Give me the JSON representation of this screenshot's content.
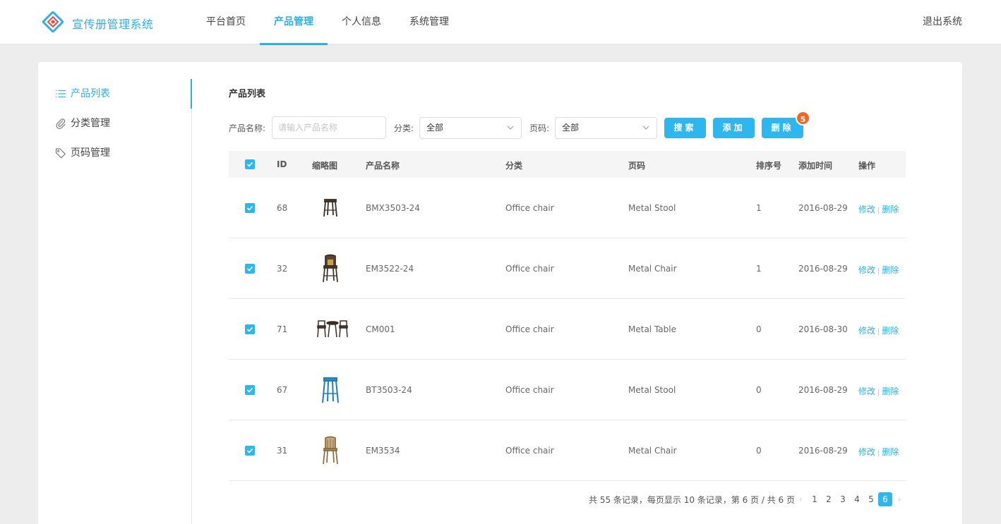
{
  "app": {
    "title": "宣传册管理系统"
  },
  "nav": {
    "items": [
      {
        "label": "平台首页"
      },
      {
        "label": "产品管理"
      },
      {
        "label": "个人信息"
      },
      {
        "label": "系统管理"
      }
    ],
    "active": "产品管理",
    "logout": "退出系统"
  },
  "sidebar": {
    "items": [
      {
        "label": "产品列表",
        "icon": "list-icon"
      },
      {
        "label": "分类管理",
        "icon": "paperclip-icon"
      },
      {
        "label": "页码管理",
        "icon": "tag-icon"
      }
    ],
    "active": "产品列表"
  },
  "content": {
    "title": "产品列表"
  },
  "filters": {
    "name_label": "产品名称:",
    "name_placeholder": "请输入产品名称",
    "category_label": "分类:",
    "category_value": "全部",
    "page_label": "页码:",
    "page_value": "全部",
    "search_label": "搜索",
    "add_label": "添加",
    "delete_label": "删除",
    "delete_badge": "5"
  },
  "table": {
    "headers": {
      "id": "ID",
      "thumb": "缩略图",
      "name": "产品名称",
      "category": "分类",
      "page": "页码",
      "sort": "排序号",
      "date": "添加时间",
      "ops": "操作"
    },
    "rows": [
      {
        "id": "68",
        "name": "BMX3503-24",
        "category": "Office chair",
        "page": "Metal Stool",
        "sort": "1",
        "date": "2016-08-29",
        "thumb": "bar-stool"
      },
      {
        "id": "32",
        "name": "EM3522-24",
        "category": "Office chair",
        "page": "Metal Chair",
        "sort": "1",
        "date": "2016-08-29",
        "thumb": "high-back-chair"
      },
      {
        "id": "71",
        "name": "CM001",
        "category": "Office chair",
        "page": "Metal Table",
        "sort": "0",
        "date": "2016-08-30",
        "thumb": "table-set"
      },
      {
        "id": "67",
        "name": "BT3503-24",
        "category": "Office chair",
        "page": "Metal Stool",
        "sort": "0",
        "date": "2016-08-29",
        "thumb": "blue-stool"
      },
      {
        "id": "31",
        "name": "EM3534",
        "category": "Office chair",
        "page": "Metal Chair",
        "sort": "0",
        "date": "2016-08-29",
        "thumb": "chair"
      }
    ],
    "edit_label": "修改",
    "delete_label": "删除"
  },
  "pagination": {
    "info": "共 55 条记录，每页显示 10 条记录，第 6 页 / 共 6 页",
    "pages": [
      "1",
      "2",
      "3",
      "4",
      "5",
      "6"
    ],
    "current": "6",
    "prev": "‹",
    "next": "›"
  },
  "colors": {
    "accent": "#2eafe6",
    "badge": "#f26522"
  }
}
